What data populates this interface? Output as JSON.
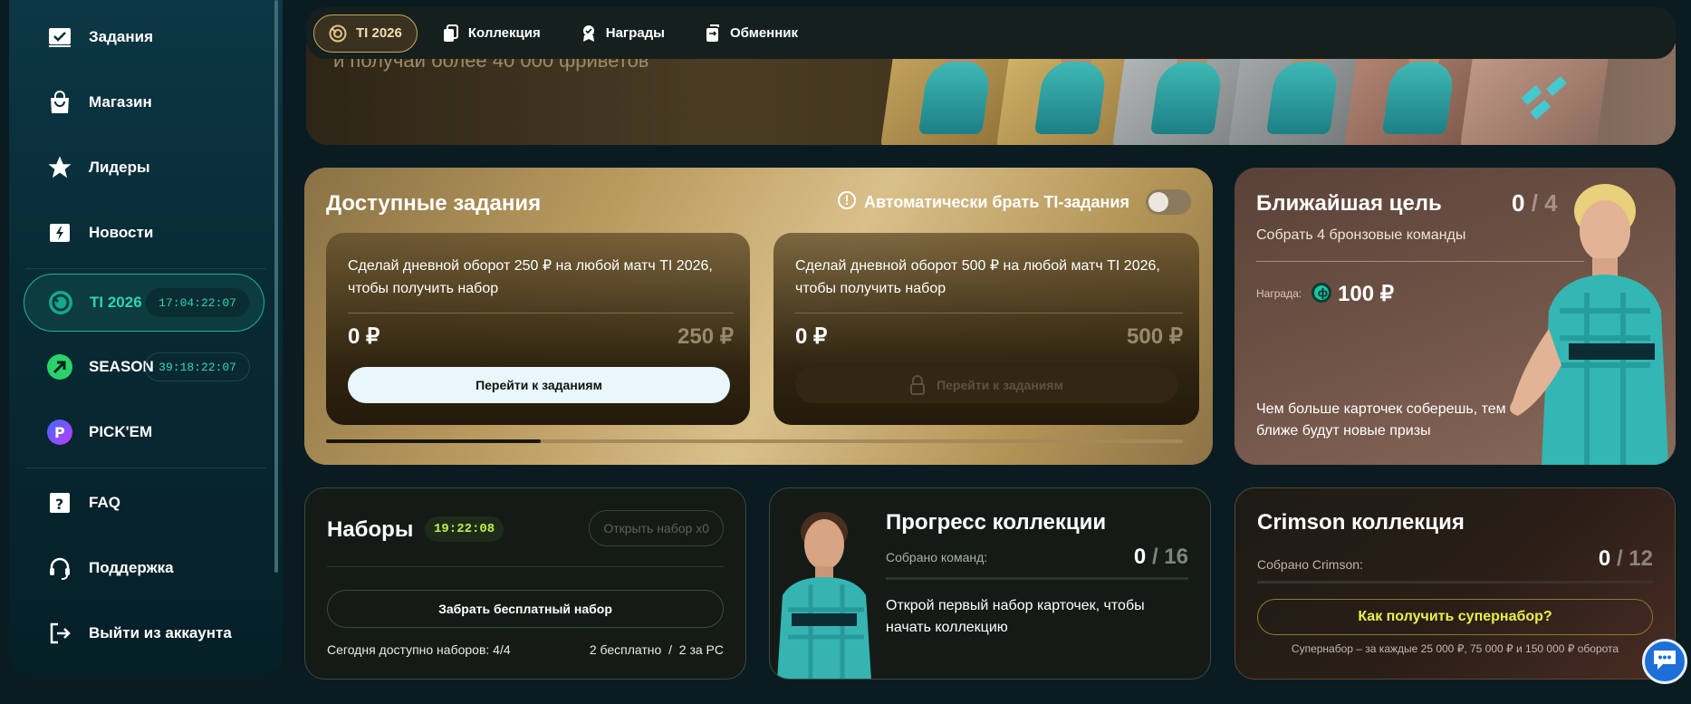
{
  "sidebar": {
    "items": [
      {
        "label": "Задания",
        "icon": "tasks-icon"
      },
      {
        "label": "Магазин",
        "icon": "shop-bag-icon"
      },
      {
        "label": "Лидеры",
        "icon": "star-icon"
      },
      {
        "label": "Новости",
        "icon": "news-icon"
      },
      {
        "label": "TI 2026",
        "icon": "ti-logo-icon",
        "timer": "17:04:22:07",
        "active": true
      },
      {
        "label": "SEASON",
        "icon": "season-arrow-icon",
        "timer": "39:18:22:07"
      },
      {
        "label": "PICK'EM",
        "icon": "pickem-icon"
      },
      {
        "label": "FAQ",
        "icon": "faq-icon"
      },
      {
        "label": "Поддержка",
        "icon": "headset-icon"
      },
      {
        "label": "Выйти из аккаунта",
        "icon": "logout-icon"
      }
    ]
  },
  "topnav": {
    "tabs": [
      {
        "label": "TI 2026",
        "icon": "ti-logo-icon",
        "active": true
      },
      {
        "label": "Коллекция",
        "icon": "cards-icon"
      },
      {
        "label": "Награды",
        "icon": "award-icon"
      },
      {
        "label": "Обменник",
        "icon": "exchange-icon"
      }
    ]
  },
  "banner": {
    "text": "и получай более 40 000 фриветов"
  },
  "tasks": {
    "title": "Доступные задания",
    "auto_label": "Автоматически брать TI-задания",
    "auto_enabled": false,
    "cards": [
      {
        "description": "Сделай дневной оборот 250 ₽ на любой матч TI 2026, чтобы получить набор",
        "current": "0 ₽",
        "goal": "250 ₽",
        "button": "Перейти к заданиям",
        "locked": false
      },
      {
        "description": "Сделай дневной оборот 500 ₽ на любой матч TI 2026, чтобы получить набор",
        "current": "0 ₽",
        "goal": "500 ₽",
        "button": "Перейти к заданиям",
        "locked": true
      }
    ],
    "carousel_progress": 0.25
  },
  "goal": {
    "title": "Ближайшая цель",
    "count": "0",
    "separator": " / ",
    "total": "4",
    "subtitle": "Собрать 4 бронзовые команды",
    "reward_label": "Награда:",
    "reward_value": "100 ₽",
    "hint": "Чем больше карточек соберешь, тем ближе будут новые призы"
  },
  "packs": {
    "title": "Наборы",
    "timer": "19:22:08",
    "open_button": "Открыть набор x0",
    "claim_button": "Забрать бесплатный набор",
    "available": "Сегодня доступно наборов: 4/4",
    "breakdown": "2 бесплатно  /  2 за PC"
  },
  "collection": {
    "title": "Прогресс коллекции",
    "label": "Собрано команд:",
    "count": "0",
    "separator": " / ",
    "total": "16",
    "text": "Открой первый набор карточек, чтобы начать коллекцию"
  },
  "crimson": {
    "title": "Crimson коллекция",
    "label": "Собрано Crimson:",
    "count": "0",
    "separator": " / ",
    "total": "12",
    "button": "Как получить супернабор?",
    "note": "Супернабор – за каждые 25 000 ₽, 75 000 ₽ и 150 000 ₽ оборота"
  },
  "colors": {
    "accent_teal": "#2fd3b6",
    "gold": "#c9a75d",
    "lime": "#b7f24a",
    "chat_blue": "#1e6fd8"
  }
}
